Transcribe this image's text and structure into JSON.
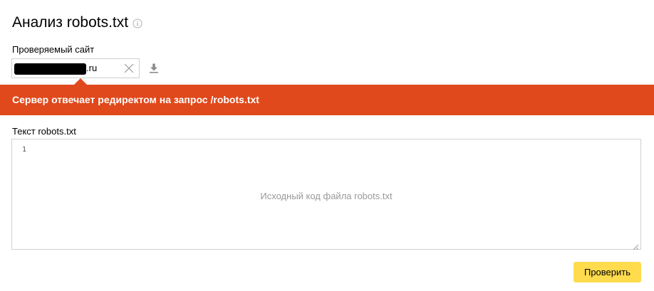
{
  "page": {
    "title": "Анализ robots.txt"
  },
  "site": {
    "label": "Проверяемый сайт",
    "value_suffix": ".ru"
  },
  "error": {
    "message": "Сервер отвечает редиректом на запрос /robots.txt",
    "color": "#e0491b"
  },
  "robots": {
    "label": "Текст robots.txt",
    "line_number": "1",
    "placeholder": "Исходный код файла robots.txt"
  },
  "actions": {
    "check_label": "Проверить",
    "check_color": "#ffdb4d"
  },
  "icons": {
    "info": "info-icon",
    "clear": "close-icon",
    "download": "download-icon",
    "resize": "resize-handle-icon"
  }
}
